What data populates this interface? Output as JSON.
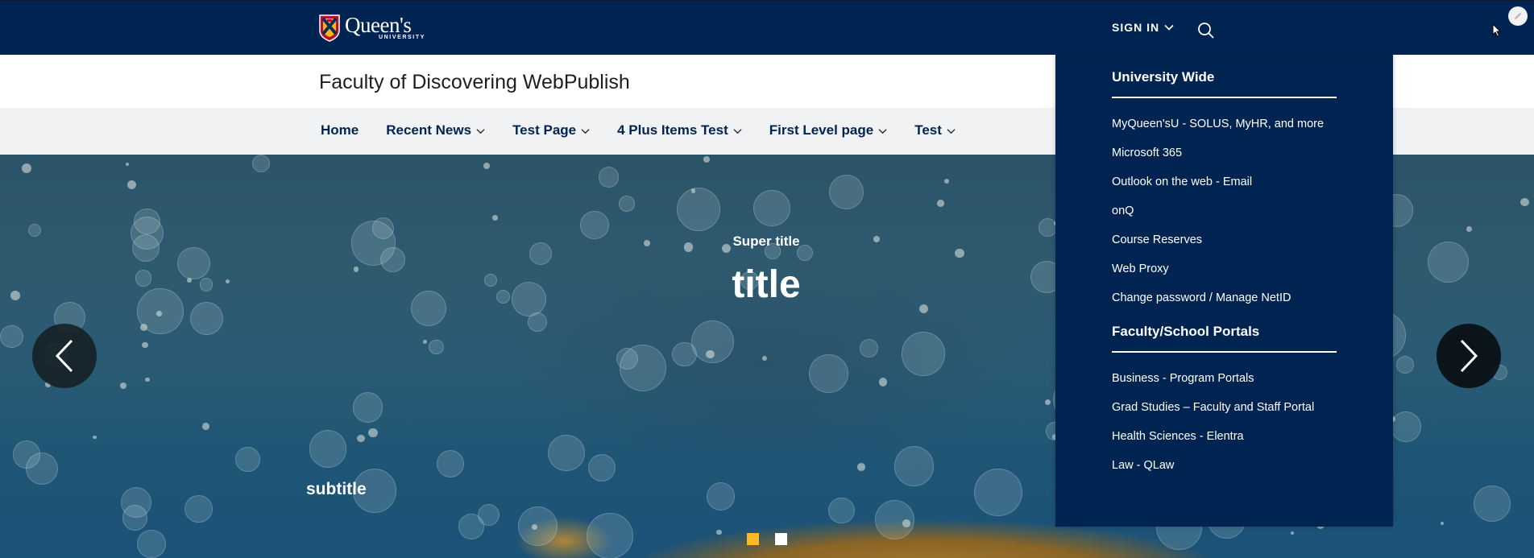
{
  "header": {
    "logo_wordmark": "Queen's",
    "logo_subtext": "UNIVERSITY",
    "sign_in_label": "SIGN IN",
    "icons": {
      "sign_in_chevron": "chevron-down-icon",
      "search": "search-icon",
      "edit": "pencil-icon"
    }
  },
  "site": {
    "title": "Faculty of Discovering WebPublish"
  },
  "nav": {
    "items": [
      {
        "label": "Home",
        "has_dropdown": false
      },
      {
        "label": "Recent News",
        "has_dropdown": true
      },
      {
        "label": "Test Page",
        "has_dropdown": true
      },
      {
        "label": "4 Plus Items Test",
        "has_dropdown": true
      },
      {
        "label": "First Level page",
        "has_dropdown": true
      },
      {
        "label": "Test",
        "has_dropdown": true
      }
    ]
  },
  "hero": {
    "supertitle": "Super title",
    "title": "title",
    "subtitle": "subtitle",
    "prev_icon": "chevron-left-icon",
    "next_icon": "chevron-right-icon",
    "slides_total": 2,
    "active_slide": 1,
    "colors": {
      "dot_active": "#fbb829",
      "dot_inactive": "#ffffff"
    }
  },
  "signin_dropdown": {
    "sections": [
      {
        "heading": "University Wide",
        "links": [
          "MyQueen'sU - SOLUS, MyHR, and more",
          "Microsoft 365",
          "Outlook on the web - Email",
          "onQ",
          "Course Reserves",
          "Web Proxy",
          "Change password / Manage NetID"
        ]
      },
      {
        "heading": "Faculty/School Portals",
        "links": [
          "Business - Program Portals",
          "Grad Studies – Faculty and Staff Portal",
          "Health Sciences - Elentra",
          "Law - QLaw"
        ]
      }
    ]
  },
  "colors": {
    "navy": "#002452",
    "nav_bg": "#f1f2f3",
    "gold": "#fbb829"
  }
}
